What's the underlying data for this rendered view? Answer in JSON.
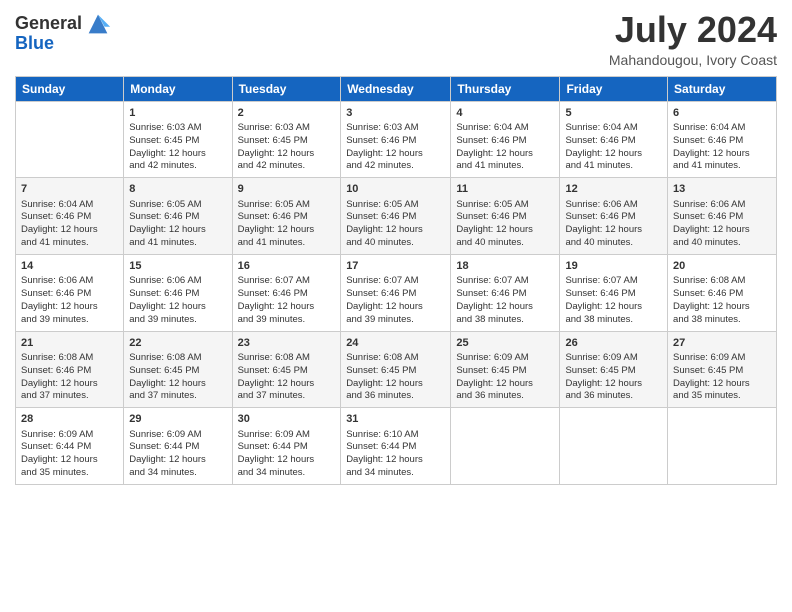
{
  "logo": {
    "line1": "General",
    "line2": "Blue"
  },
  "title": "July 2024",
  "subtitle": "Mahandougou, Ivory Coast",
  "days_header": [
    "Sunday",
    "Monday",
    "Tuesday",
    "Wednesday",
    "Thursday",
    "Friday",
    "Saturday"
  ],
  "weeks": [
    [
      {
        "day": "",
        "info": ""
      },
      {
        "day": "1",
        "info": "Sunrise: 6:03 AM\nSunset: 6:45 PM\nDaylight: 12 hours\nand 42 minutes."
      },
      {
        "day": "2",
        "info": "Sunrise: 6:03 AM\nSunset: 6:45 PM\nDaylight: 12 hours\nand 42 minutes."
      },
      {
        "day": "3",
        "info": "Sunrise: 6:03 AM\nSunset: 6:46 PM\nDaylight: 12 hours\nand 42 minutes."
      },
      {
        "day": "4",
        "info": "Sunrise: 6:04 AM\nSunset: 6:46 PM\nDaylight: 12 hours\nand 41 minutes."
      },
      {
        "day": "5",
        "info": "Sunrise: 6:04 AM\nSunset: 6:46 PM\nDaylight: 12 hours\nand 41 minutes."
      },
      {
        "day": "6",
        "info": "Sunrise: 6:04 AM\nSunset: 6:46 PM\nDaylight: 12 hours\nand 41 minutes."
      }
    ],
    [
      {
        "day": "7",
        "info": "Sunrise: 6:04 AM\nSunset: 6:46 PM\nDaylight: 12 hours\nand 41 minutes."
      },
      {
        "day": "8",
        "info": "Sunrise: 6:05 AM\nSunset: 6:46 PM\nDaylight: 12 hours\nand 41 minutes."
      },
      {
        "day": "9",
        "info": "Sunrise: 6:05 AM\nSunset: 6:46 PM\nDaylight: 12 hours\nand 41 minutes."
      },
      {
        "day": "10",
        "info": "Sunrise: 6:05 AM\nSunset: 6:46 PM\nDaylight: 12 hours\nand 40 minutes."
      },
      {
        "day": "11",
        "info": "Sunrise: 6:05 AM\nSunset: 6:46 PM\nDaylight: 12 hours\nand 40 minutes."
      },
      {
        "day": "12",
        "info": "Sunrise: 6:06 AM\nSunset: 6:46 PM\nDaylight: 12 hours\nand 40 minutes."
      },
      {
        "day": "13",
        "info": "Sunrise: 6:06 AM\nSunset: 6:46 PM\nDaylight: 12 hours\nand 40 minutes."
      }
    ],
    [
      {
        "day": "14",
        "info": "Sunrise: 6:06 AM\nSunset: 6:46 PM\nDaylight: 12 hours\nand 39 minutes."
      },
      {
        "day": "15",
        "info": "Sunrise: 6:06 AM\nSunset: 6:46 PM\nDaylight: 12 hours\nand 39 minutes."
      },
      {
        "day": "16",
        "info": "Sunrise: 6:07 AM\nSunset: 6:46 PM\nDaylight: 12 hours\nand 39 minutes."
      },
      {
        "day": "17",
        "info": "Sunrise: 6:07 AM\nSunset: 6:46 PM\nDaylight: 12 hours\nand 39 minutes."
      },
      {
        "day": "18",
        "info": "Sunrise: 6:07 AM\nSunset: 6:46 PM\nDaylight: 12 hours\nand 38 minutes."
      },
      {
        "day": "19",
        "info": "Sunrise: 6:07 AM\nSunset: 6:46 PM\nDaylight: 12 hours\nand 38 minutes."
      },
      {
        "day": "20",
        "info": "Sunrise: 6:08 AM\nSunset: 6:46 PM\nDaylight: 12 hours\nand 38 minutes."
      }
    ],
    [
      {
        "day": "21",
        "info": "Sunrise: 6:08 AM\nSunset: 6:46 PM\nDaylight: 12 hours\nand 37 minutes."
      },
      {
        "day": "22",
        "info": "Sunrise: 6:08 AM\nSunset: 6:45 PM\nDaylight: 12 hours\nand 37 minutes."
      },
      {
        "day": "23",
        "info": "Sunrise: 6:08 AM\nSunset: 6:45 PM\nDaylight: 12 hours\nand 37 minutes."
      },
      {
        "day": "24",
        "info": "Sunrise: 6:08 AM\nSunset: 6:45 PM\nDaylight: 12 hours\nand 36 minutes."
      },
      {
        "day": "25",
        "info": "Sunrise: 6:09 AM\nSunset: 6:45 PM\nDaylight: 12 hours\nand 36 minutes."
      },
      {
        "day": "26",
        "info": "Sunrise: 6:09 AM\nSunset: 6:45 PM\nDaylight: 12 hours\nand 36 minutes."
      },
      {
        "day": "27",
        "info": "Sunrise: 6:09 AM\nSunset: 6:45 PM\nDaylight: 12 hours\nand 35 minutes."
      }
    ],
    [
      {
        "day": "28",
        "info": "Sunrise: 6:09 AM\nSunset: 6:44 PM\nDaylight: 12 hours\nand 35 minutes."
      },
      {
        "day": "29",
        "info": "Sunrise: 6:09 AM\nSunset: 6:44 PM\nDaylight: 12 hours\nand 34 minutes."
      },
      {
        "day": "30",
        "info": "Sunrise: 6:09 AM\nSunset: 6:44 PM\nDaylight: 12 hours\nand 34 minutes."
      },
      {
        "day": "31",
        "info": "Sunrise: 6:10 AM\nSunset: 6:44 PM\nDaylight: 12 hours\nand 34 minutes."
      },
      {
        "day": "",
        "info": ""
      },
      {
        "day": "",
        "info": ""
      },
      {
        "day": "",
        "info": ""
      }
    ]
  ]
}
